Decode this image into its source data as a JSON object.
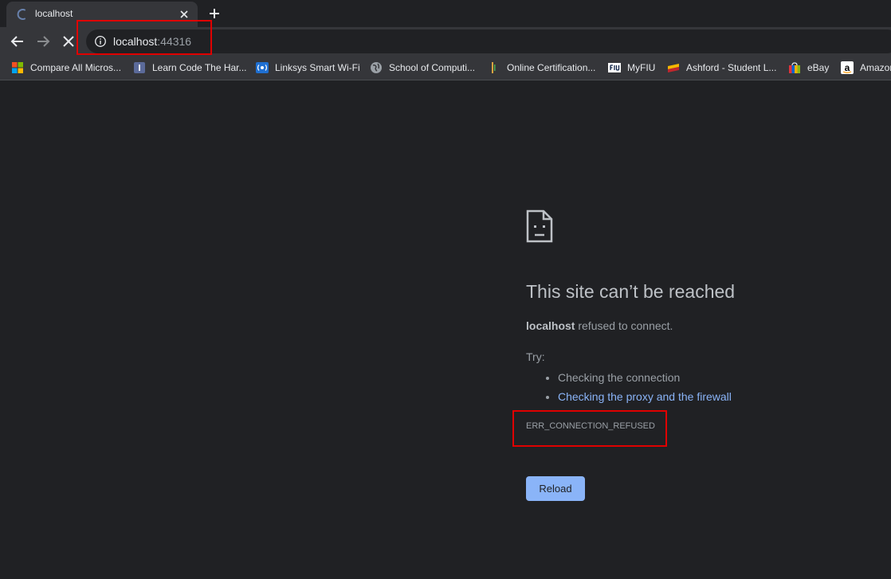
{
  "tab": {
    "title": "localhost"
  },
  "omnibox": {
    "host": "localhost",
    "port": ":44316"
  },
  "bookmarks": [
    {
      "label": "Compare All Micros...",
      "icon": "microsoft-icon"
    },
    {
      "label": "Learn Code The Har...",
      "icon": "bookmark-favicon-icon"
    },
    {
      "label": "Linksys Smart Wi-Fi",
      "icon": "linksys-icon"
    },
    {
      "label": "School of Computi...",
      "icon": "globe-icon"
    },
    {
      "label": "Online Certification...",
      "icon": "certification-icon"
    },
    {
      "label": "MyFIU",
      "icon": "fiu-icon"
    },
    {
      "label": "Ashford - Student L...",
      "icon": "ashford-icon"
    },
    {
      "label": "eBay",
      "icon": "ebay-icon"
    },
    {
      "label": "Amazon",
      "icon": "amazon-icon"
    }
  ],
  "error": {
    "title": "This site can’t be reached",
    "host": "localhost",
    "description": " refused to connect.",
    "try_label": "Try:",
    "suggestions": [
      "Checking the connection",
      "Checking the proxy and the firewall"
    ],
    "code": "ERR_CONNECTION_REFUSED",
    "reload_label": "Reload"
  },
  "colors": {
    "background": "#202124",
    "link": "#8ab4f8",
    "highlight": "#e00000"
  }
}
